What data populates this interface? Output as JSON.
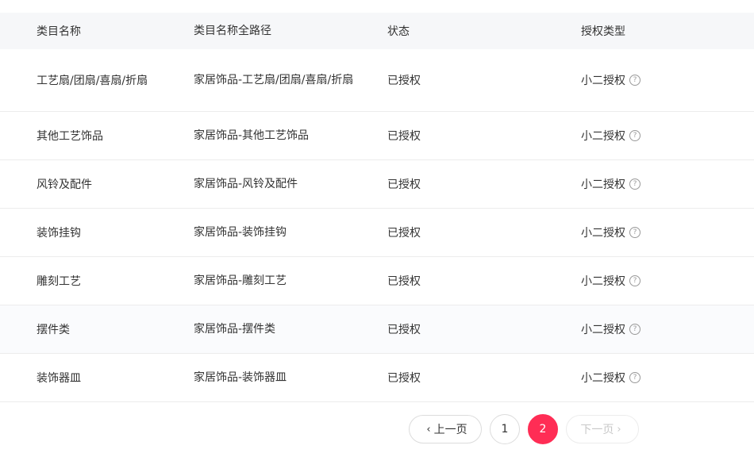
{
  "table": {
    "headers": [
      "类目名称",
      "类目名称全路径",
      "状态",
      "授权类型"
    ],
    "rows": [
      {
        "name": "工艺扇/团扇/喜扇/折扇",
        "path": "家居饰品-工艺扇/团扇/喜扇/折扇",
        "status": "已授权",
        "auth_type": "小二授权"
      },
      {
        "name": "其他工艺饰品",
        "path": "家居饰品-其他工艺饰品",
        "status": "已授权",
        "auth_type": "小二授权"
      },
      {
        "name": "风铃及配件",
        "path": "家居饰品-风铃及配件",
        "status": "已授权",
        "auth_type": "小二授权"
      },
      {
        "name": "装饰挂钩",
        "path": "家居饰品-装饰挂钩",
        "status": "已授权",
        "auth_type": "小二授权"
      },
      {
        "name": "雕刻工艺",
        "path": "家居饰品-雕刻工艺",
        "status": "已授权",
        "auth_type": "小二授权"
      },
      {
        "name": "摆件类",
        "path": "家居饰品-摆件类",
        "status": "已授权",
        "auth_type": "小二授权"
      },
      {
        "name": "装饰器皿",
        "path": "家居饰品-装饰器皿",
        "status": "已授权",
        "auth_type": "小二授权"
      }
    ]
  },
  "pagination": {
    "prev_label": "上一页",
    "next_label": "下一页",
    "pages": [
      "1",
      "2"
    ],
    "current_page": "2",
    "prev_icon": "chevron-left-icon",
    "next_icon": "chevron-right-icon",
    "accent_color": "#ff2d55"
  },
  "help_icon": "question-circle-icon"
}
